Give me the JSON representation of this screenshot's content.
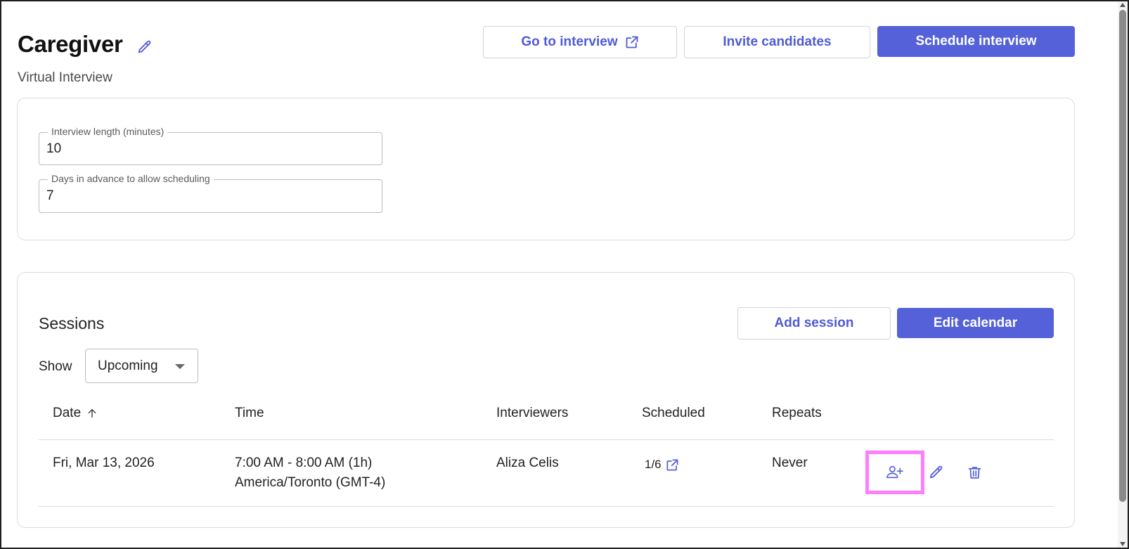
{
  "header": {
    "title": "Caregiver",
    "subtitle": "Virtual Interview",
    "go_to_interview_label": "Go to interview",
    "invite_candidates_label": "Invite candidates",
    "schedule_interview_label": "Schedule interview"
  },
  "settings": {
    "interview_length_label": "Interview length (minutes)",
    "interview_length_value": "10",
    "days_in_advance_label": "Days in advance to allow scheduling",
    "days_in_advance_value": "7"
  },
  "sessions": {
    "title": "Sessions",
    "add_session_label": "Add session",
    "edit_calendar_label": "Edit calendar",
    "show_label": "Show",
    "show_selected": "Upcoming",
    "columns": {
      "date": "Date",
      "time": "Time",
      "interviewers": "Interviewers",
      "scheduled": "Scheduled",
      "repeats": "Repeats"
    },
    "rows": [
      {
        "date": "Fri, Mar 13, 2026",
        "time_line1": "7:00 AM - 8:00 AM (1h)",
        "time_line2": "America/Toronto (GMT-4)",
        "interviewers": "Aliza Celis",
        "scheduled": "1/6",
        "repeats": "Never"
      }
    ]
  },
  "colors": {
    "accent": "#5561d9",
    "highlight": "#ff7dff"
  },
  "icons": {
    "title_edit": "pencil-icon",
    "external_link": "external-link-icon",
    "sort": "arrow-up-icon",
    "add_candidate": "person-add-icon",
    "edit": "pencil-icon",
    "delete": "trash-icon"
  }
}
